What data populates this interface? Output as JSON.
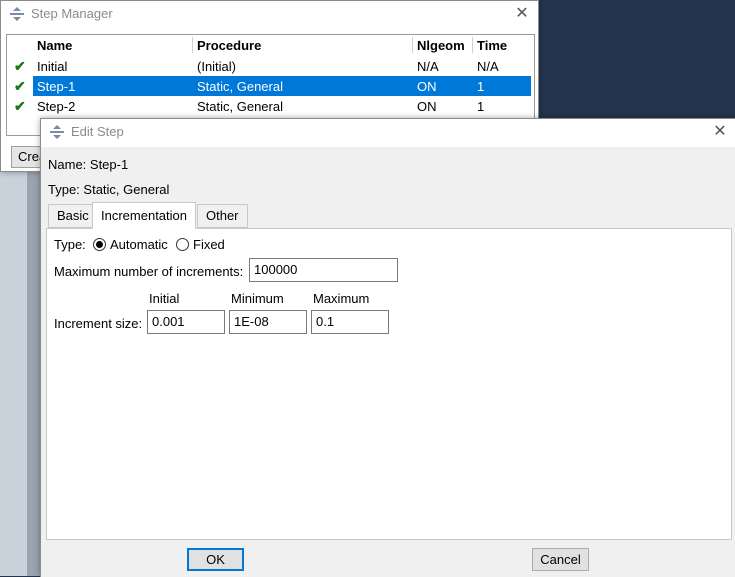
{
  "step_manager": {
    "title": "Step Manager",
    "columns": [
      "Name",
      "Procedure",
      "Nlgeom",
      "Time"
    ],
    "rows": [
      {
        "name": "Initial",
        "procedure": "(Initial)",
        "nlgeom": "N/A",
        "time": "N/A",
        "checked": true,
        "selected": false
      },
      {
        "name": "Step-1",
        "procedure": "Static, General",
        "nlgeom": "ON",
        "time": "1",
        "checked": true,
        "selected": true
      },
      {
        "name": "Step-2",
        "procedure": "Static, General",
        "nlgeom": "ON",
        "time": "1",
        "checked": true,
        "selected": false
      }
    ],
    "create_label": "Crea",
    "check_glyph": "✔",
    "close_glyph": "✕"
  },
  "edit_step": {
    "title": "Edit Step",
    "close_glyph": "✕",
    "name_line": "Name:  Step-1",
    "type_line": "Type:  Static, General",
    "tabs": [
      "Basic",
      "Incrementation",
      "Other"
    ],
    "active_tab": "Incrementation",
    "incrementation": {
      "type_label": "Type:",
      "type_options": [
        "Automatic",
        "Fixed"
      ],
      "type_selected": "Automatic",
      "max_increments_label": "Maximum number of increments:",
      "max_increments_value": "100000",
      "col_initial": "Initial",
      "col_minimum": "Minimum",
      "col_maximum": "Maximum",
      "increment_size_label": "Increment size:",
      "initial_value": "0.001",
      "minimum_value": "1E-08",
      "maximum_value": "0.1"
    },
    "ok_label": "OK",
    "cancel_label": "Cancel"
  },
  "colors": {
    "selection": "#0078d7",
    "check": "#1a7a1a",
    "desktop": "#24344e"
  }
}
